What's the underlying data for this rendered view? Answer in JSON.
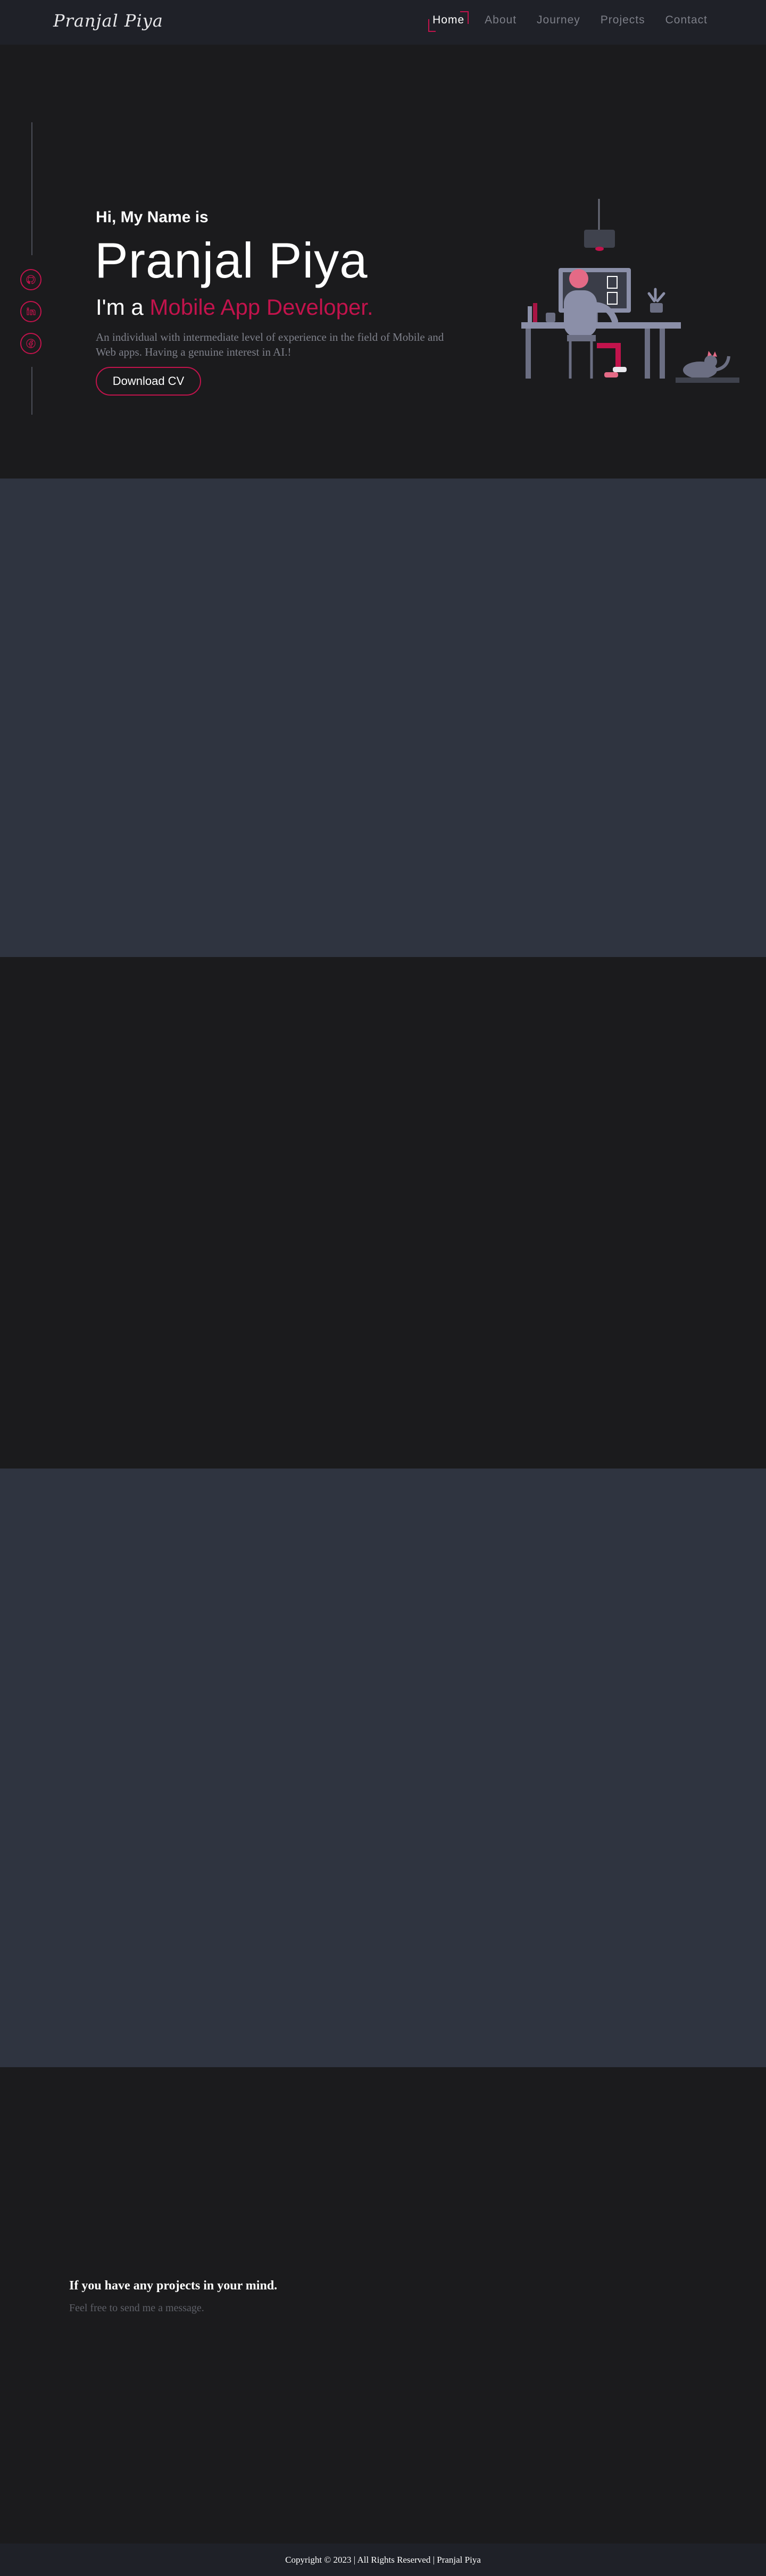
{
  "brand": "Pranjal Piya",
  "nav": {
    "items": [
      "Home",
      "About",
      "Journey",
      "Projects",
      "Contact"
    ],
    "active": "Home"
  },
  "social": [
    {
      "icon": "github-icon"
    },
    {
      "icon": "linkedin-icon"
    },
    {
      "icon": "facebook-icon"
    }
  ],
  "hero": {
    "greeting": "Hi, My Name is",
    "name": "Pranjal Piya",
    "role_prefix": "I'm a",
    "role": "Mobile App Developer.",
    "description": "An individual with intermediate level of experience in the field of Mobile and Web apps. Having a genuine interest in AI.!",
    "cta": "Download CV"
  },
  "contact": {
    "title": "If you have any projects in your mind.",
    "subtitle": "Feel free to send me a message."
  },
  "footer": {
    "text": "Copyright © 2023 | All Rights Reserved | Pranjal Piya"
  },
  "colors": {
    "accent": "#c2134c",
    "background": "#1b1b1d",
    "band": "#2f3440",
    "nav": "#1f2128"
  }
}
